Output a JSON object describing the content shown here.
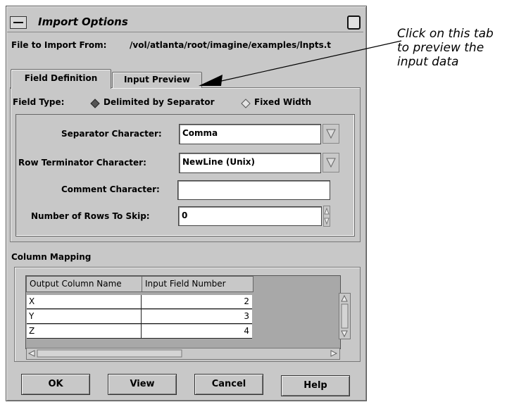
{
  "window": {
    "title": "Import Options"
  },
  "file_row": {
    "label": "File to Import From:",
    "path": "/vol/atlanta/root/imagine/examples/lnpts.t"
  },
  "tabs": [
    {
      "label": "Field Definition"
    },
    {
      "label": "Input Preview"
    }
  ],
  "field_type": {
    "label": "Field Type:",
    "options": [
      {
        "label": "Delimited by Separator",
        "selected": true
      },
      {
        "label": "Fixed Width",
        "selected": false
      }
    ]
  },
  "separator": {
    "label": "Separator Character:",
    "value": "Comma"
  },
  "row_terminator": {
    "label": "Row Terminator Character:",
    "value": "NewLine (Unix)"
  },
  "comment": {
    "label": "Comment Character:",
    "value": ""
  },
  "rows_to_skip": {
    "label": "Number of Rows To Skip:",
    "value": "0"
  },
  "column_mapping": {
    "title": "Column Mapping",
    "headers": [
      "Output Column Name",
      "Input Field Number"
    ],
    "rows": [
      {
        "name": "X",
        "field": "2"
      },
      {
        "name": "Y",
        "field": "3"
      },
      {
        "name": "Z",
        "field": "4"
      }
    ]
  },
  "buttons": {
    "ok": "OK",
    "view": "View",
    "cancel": "Cancel",
    "help": "Help"
  },
  "annotation": {
    "line1": "Click on this tab",
    "line2": "to preview the",
    "line3": "input data"
  }
}
